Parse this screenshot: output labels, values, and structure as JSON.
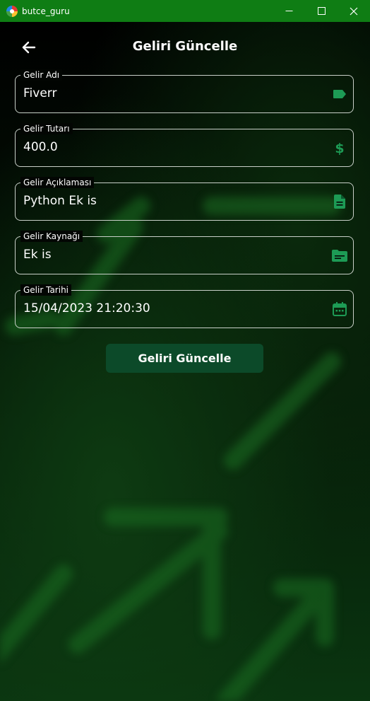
{
  "window": {
    "title": "butce_guru",
    "controls": {
      "minimize": "─",
      "maximize": "☐",
      "close": "✕"
    }
  },
  "header": {
    "back_icon": "arrow-left-icon",
    "title": "Geliri Güncelle"
  },
  "form": {
    "fields": [
      {
        "label": "Gelir Adı",
        "value": "Fiverr",
        "icon": "label-tag-icon"
      },
      {
        "label": "Gelir Tutarı",
        "value": "400.0",
        "icon": "dollar-icon"
      },
      {
        "label": "Gelir Açıklaması",
        "value": "Python Ek is",
        "icon": "document-icon"
      },
      {
        "label": "Gelir Kaynağı",
        "value": "Ek is",
        "icon": "folder-icon"
      },
      {
        "label": "Gelir Tarihi",
        "value": "15/04/2023 21:20:30",
        "icon": "calendar-icon"
      }
    ],
    "submit_label": "Geliri Güncelle"
  },
  "colors": {
    "titlebar": "#0f7d14",
    "accent_icon": "#1d9b55",
    "button": "#0c4a29",
    "field_border": "#c8cfc8",
    "text": "#ffffff"
  }
}
